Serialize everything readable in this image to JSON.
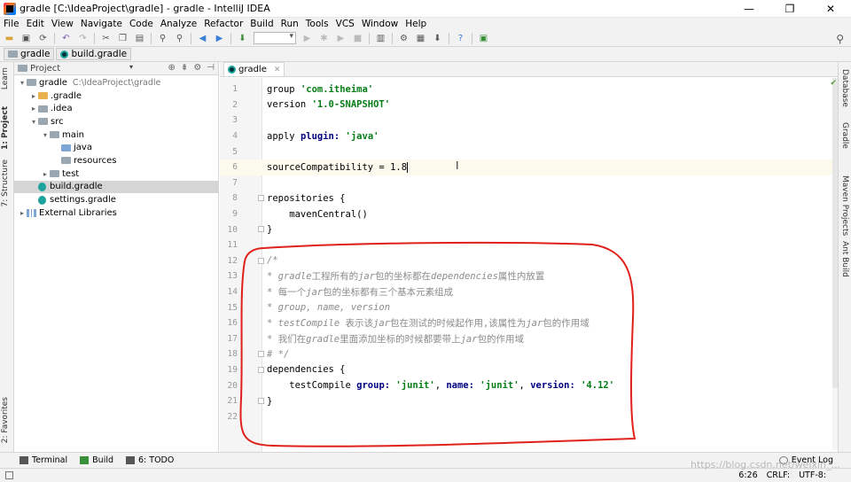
{
  "window": {
    "title": "gradle [C:\\IdeaProject\\gradle] - gradle - IntelliJ IDEA",
    "minimize": "—",
    "maximize": "❐",
    "close": "✕"
  },
  "menu": [
    "File",
    "Edit",
    "View",
    "Navigate",
    "Code",
    "Analyze",
    "Refactor",
    "Build",
    "Run",
    "Tools",
    "VCS",
    "Window",
    "Help"
  ],
  "breadcrumb": {
    "project": "gradle",
    "file": "build.gradle"
  },
  "left_tabs": {
    "learn": "Learn",
    "project": "1: Project",
    "structure": "7: Structure",
    "favorites": "2: Favorites"
  },
  "right_tabs": {
    "database": "Database",
    "gradle": "Gradle",
    "maven": "Maven Projects",
    "ant": "Ant Build"
  },
  "project_panel": {
    "title": "Project",
    "tree": [
      {
        "label": "gradle",
        "path": "C:\\IdeaProject\\gradle",
        "indent": 0,
        "arrow": "▾",
        "icon": "folder-gray"
      },
      {
        "label": ".gradle",
        "path": "",
        "indent": 1,
        "arrow": "▸",
        "icon": "folder-yellow"
      },
      {
        "label": ".idea",
        "path": "",
        "indent": 1,
        "arrow": "▸",
        "icon": "folder-gray"
      },
      {
        "label": "src",
        "path": "",
        "indent": 1,
        "arrow": "▾",
        "icon": "folder-gray"
      },
      {
        "label": "main",
        "path": "",
        "indent": 2,
        "arrow": "▾",
        "icon": "folder-gray"
      },
      {
        "label": "java",
        "path": "",
        "indent": 3,
        "arrow": "",
        "icon": "folder-blue"
      },
      {
        "label": "resources",
        "path": "",
        "indent": 3,
        "arrow": "",
        "icon": "folder-gray"
      },
      {
        "label": "test",
        "path": "",
        "indent": 2,
        "arrow": "▸",
        "icon": "folder-gray"
      },
      {
        "label": "build.gradle",
        "path": "",
        "indent": 1,
        "arrow": "",
        "icon": "gradle-file",
        "selected": true
      },
      {
        "label": "settings.gradle",
        "path": "",
        "indent": 1,
        "arrow": "",
        "icon": "gradle-file"
      },
      {
        "label": "External Libraries",
        "path": "",
        "indent": 0,
        "arrow": "▸",
        "icon": "library"
      }
    ]
  },
  "editor": {
    "tab": "gradle",
    "lines": [
      {
        "n": "1",
        "html": "group <span class=\"str\">'com.itheima'</span>"
      },
      {
        "n": "2",
        "html": "version <span class=\"str\">'1.0-SNAPSHOT'</span>"
      },
      {
        "n": "3",
        "html": ""
      },
      {
        "n": "4",
        "html": "apply <span class=\"kw\">plugin:</span> <span class=\"str\">'java'</span>"
      },
      {
        "n": "5",
        "html": ""
      },
      {
        "n": "6",
        "html": "sourceCompatibility = 1.8<span class=\"caret\"></span>",
        "current": true
      },
      {
        "n": "7",
        "html": ""
      },
      {
        "n": "8",
        "html": "repositories {"
      },
      {
        "n": "9",
        "html": "    mavenCentral()"
      },
      {
        "n": "10",
        "html": "}"
      },
      {
        "n": "11",
        "html": ""
      },
      {
        "n": "12",
        "html": "<span class=\"cm\">/*</span>"
      },
      {
        "n": "13",
        "html": "<span class=\"cm\">* gradle</span><span class=\"cmi\">工程所有的</span><span class=\"cm\">jar</span><span class=\"cmi\">包的坐标都在</span><span class=\"cm\">dependencies</span><span class=\"cmi\">属性内放置</span>"
      },
      {
        "n": "14",
        "html": "<span class=\"cm\">* </span><span class=\"cmi\">每一个</span><span class=\"cm\">jar</span><span class=\"cmi\">包的坐标都有三个基本元素组成</span>"
      },
      {
        "n": "15",
        "html": "<span class=\"cm\">* group, name, version</span>"
      },
      {
        "n": "16",
        "html": "<span class=\"cm\">* testCompile </span><span class=\"cmi\">表示该</span><span class=\"cm\">jar</span><span class=\"cmi\">包在测试的时候起作用,该属性为</span><span class=\"cm\">jar</span><span class=\"cmi\">包的作用域</span>"
      },
      {
        "n": "17",
        "html": "<span class=\"cm\">* </span><span class=\"cmi\">我们在</span><span class=\"cm\">gradle</span><span class=\"cmi\">里面添加坐标的时候都要带上</span><span class=\"cm\">jar</span><span class=\"cmi\">包的作用域</span>"
      },
      {
        "n": "18",
        "html": "<span class=\"cm\"># */</span>"
      },
      {
        "n": "19",
        "html": "dependencies {"
      },
      {
        "n": "20",
        "html": "    testCompile <span class=\"kw\">group:</span> <span class=\"str\">'junit'</span>, <span class=\"kw\">name:</span> <span class=\"str\">'junit'</span>, <span class=\"kw\">version:</span> <span class=\"str\">'4.12'</span>"
      },
      {
        "n": "21",
        "html": "}"
      },
      {
        "n": "22",
        "html": ""
      }
    ]
  },
  "bottom_tabs": [
    "Terminal",
    "Build",
    "6: TODO"
  ],
  "event_log": "Event Log",
  "status": {
    "position": "6:26",
    "line_sep": "CRLF:",
    "encoding": "UTF-8:"
  },
  "watermark": "https://blog.csdn.net/weixin_..."
}
